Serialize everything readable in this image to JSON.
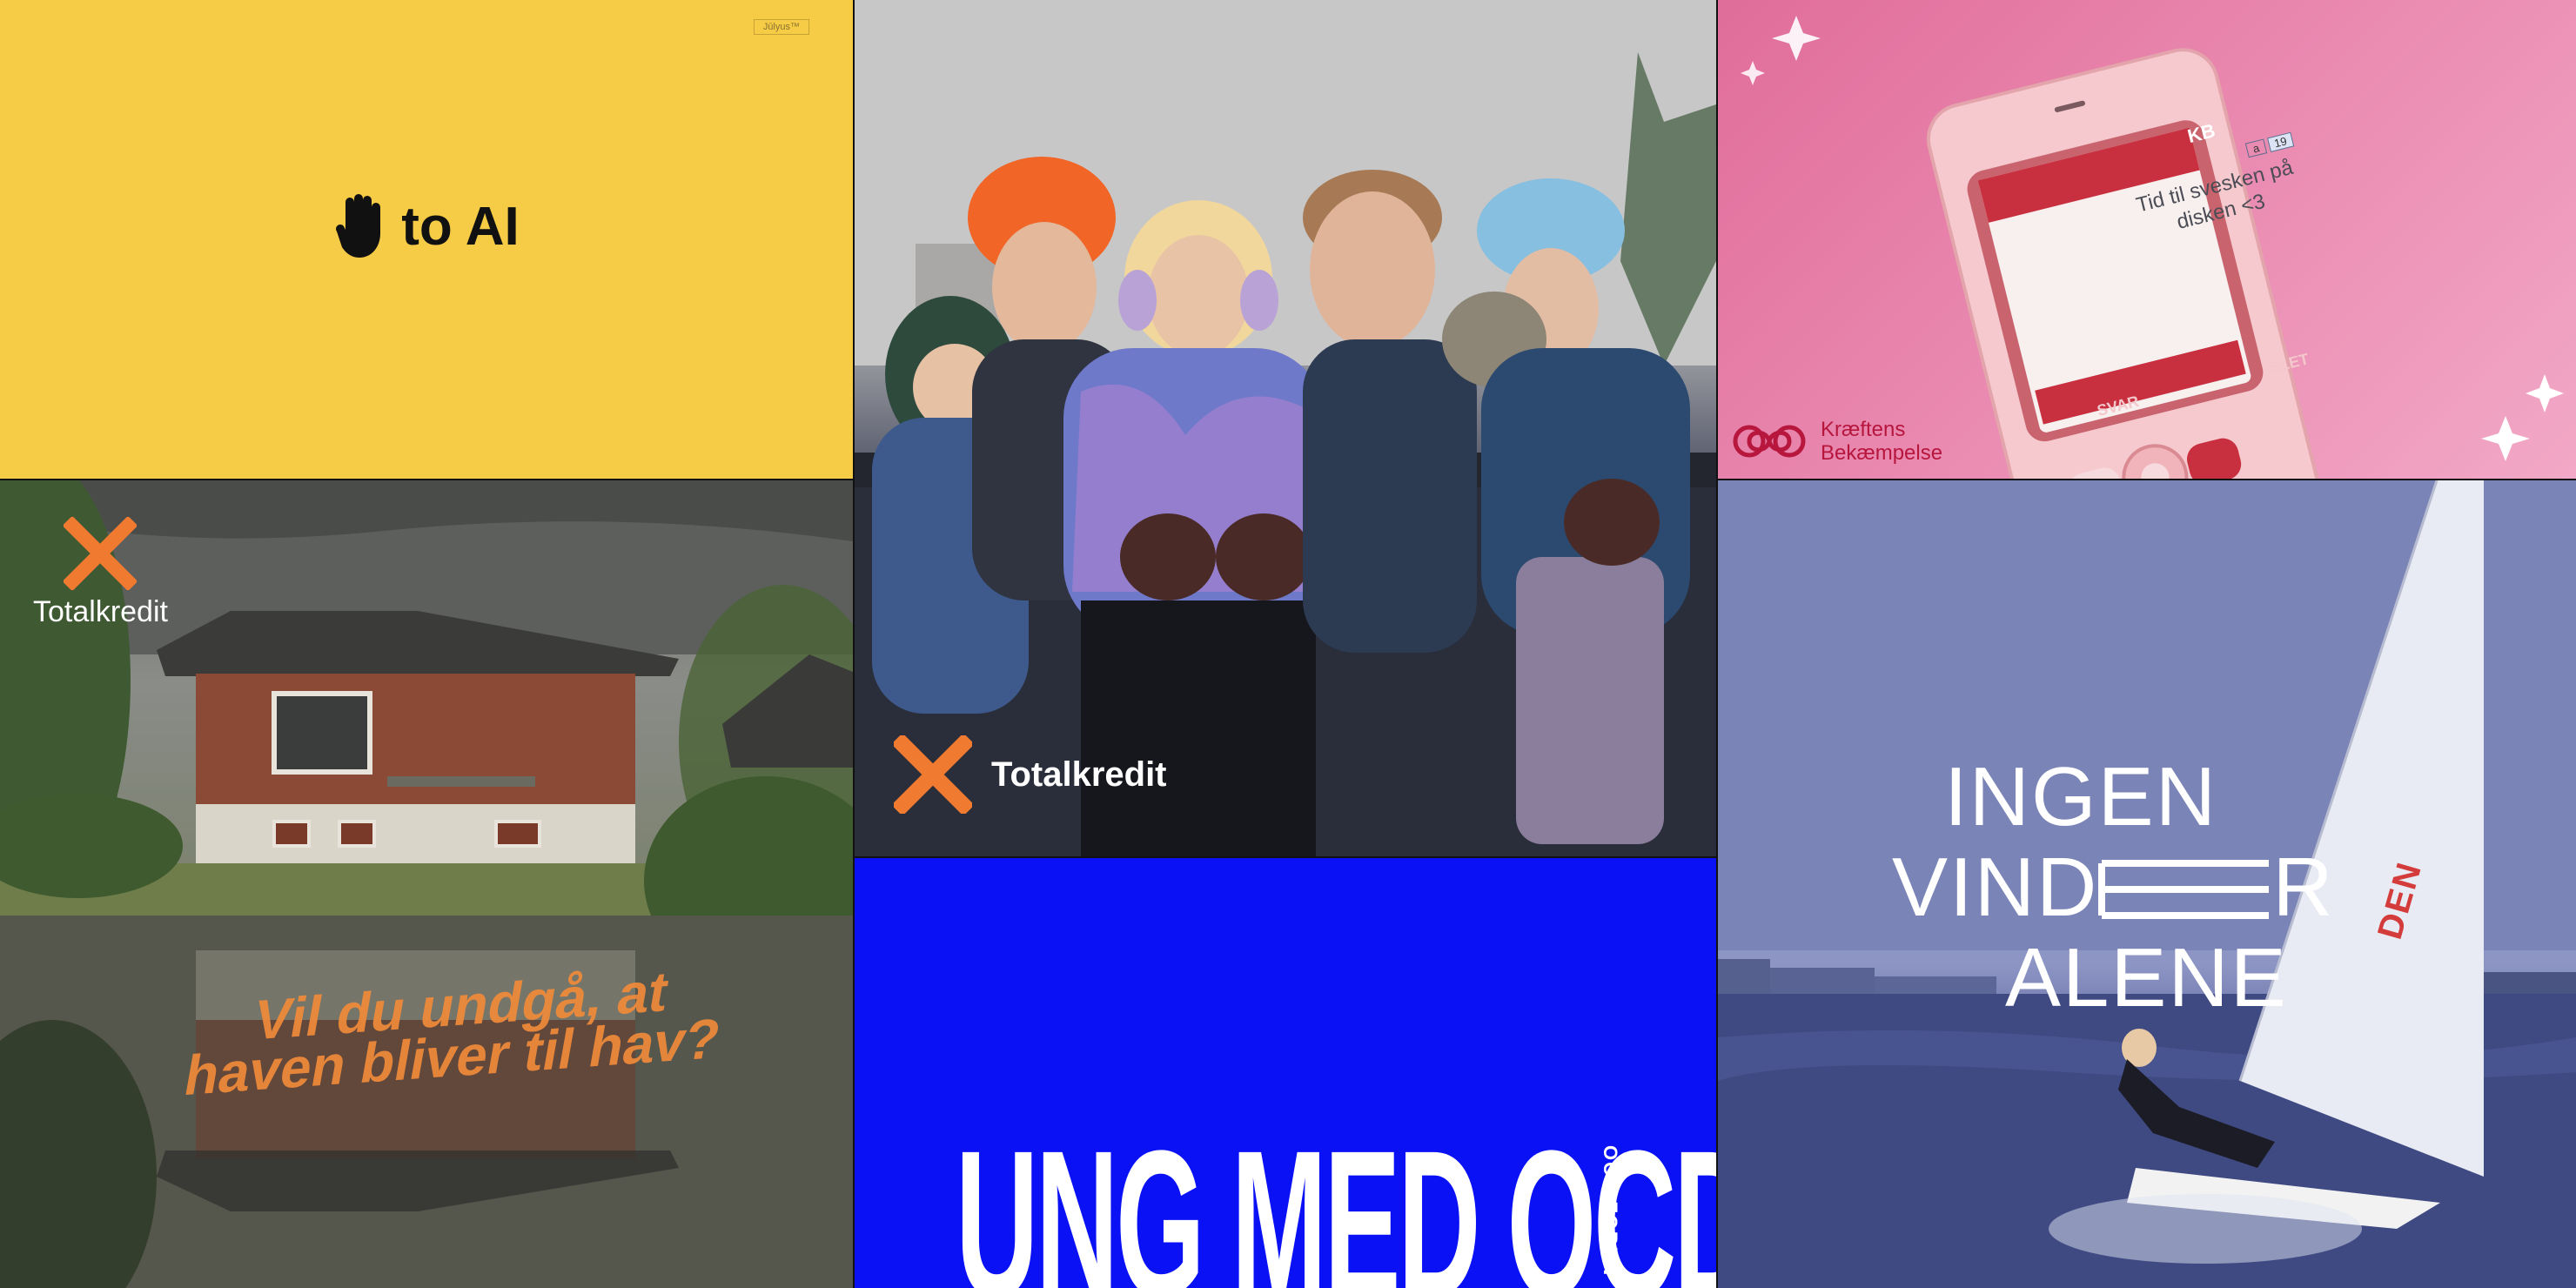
{
  "tiles": {
    "ai": {
      "tag": "Jūlyus™",
      "headline": "to AI",
      "hand_icon": "raised-hand-icon",
      "bg": "#f6cb45"
    },
    "family": {
      "brand": "Totalkredit",
      "logo_color": "#f07a30"
    },
    "cancer": {
      "phone_contact": "KB",
      "phone_message": "Tid til svesken på disken <3",
      "phone_badge_left": "a",
      "phone_badge_right": "19",
      "soft_left": "SVAR",
      "soft_right": "SLET",
      "brand_line1": "Kræftens",
      "brand_line2": "Bekæmpelse",
      "brand_color": "#b7163d"
    },
    "house": {
      "brand": "Totalkredit",
      "reflection_text": "Vil du undgå, at haven bliver til hav?",
      "text_color": "#f08b3a"
    },
    "ocd": {
      "headline": "UNG MED OCD",
      "side_text": "OCD-FOREN",
      "bg": "#0a12f5"
    },
    "sailing": {
      "line1": "INGEN",
      "line2": "VIND",
      "line2_end": "R",
      "line3": "ALENE",
      "sail_text": "DEN"
    }
  }
}
